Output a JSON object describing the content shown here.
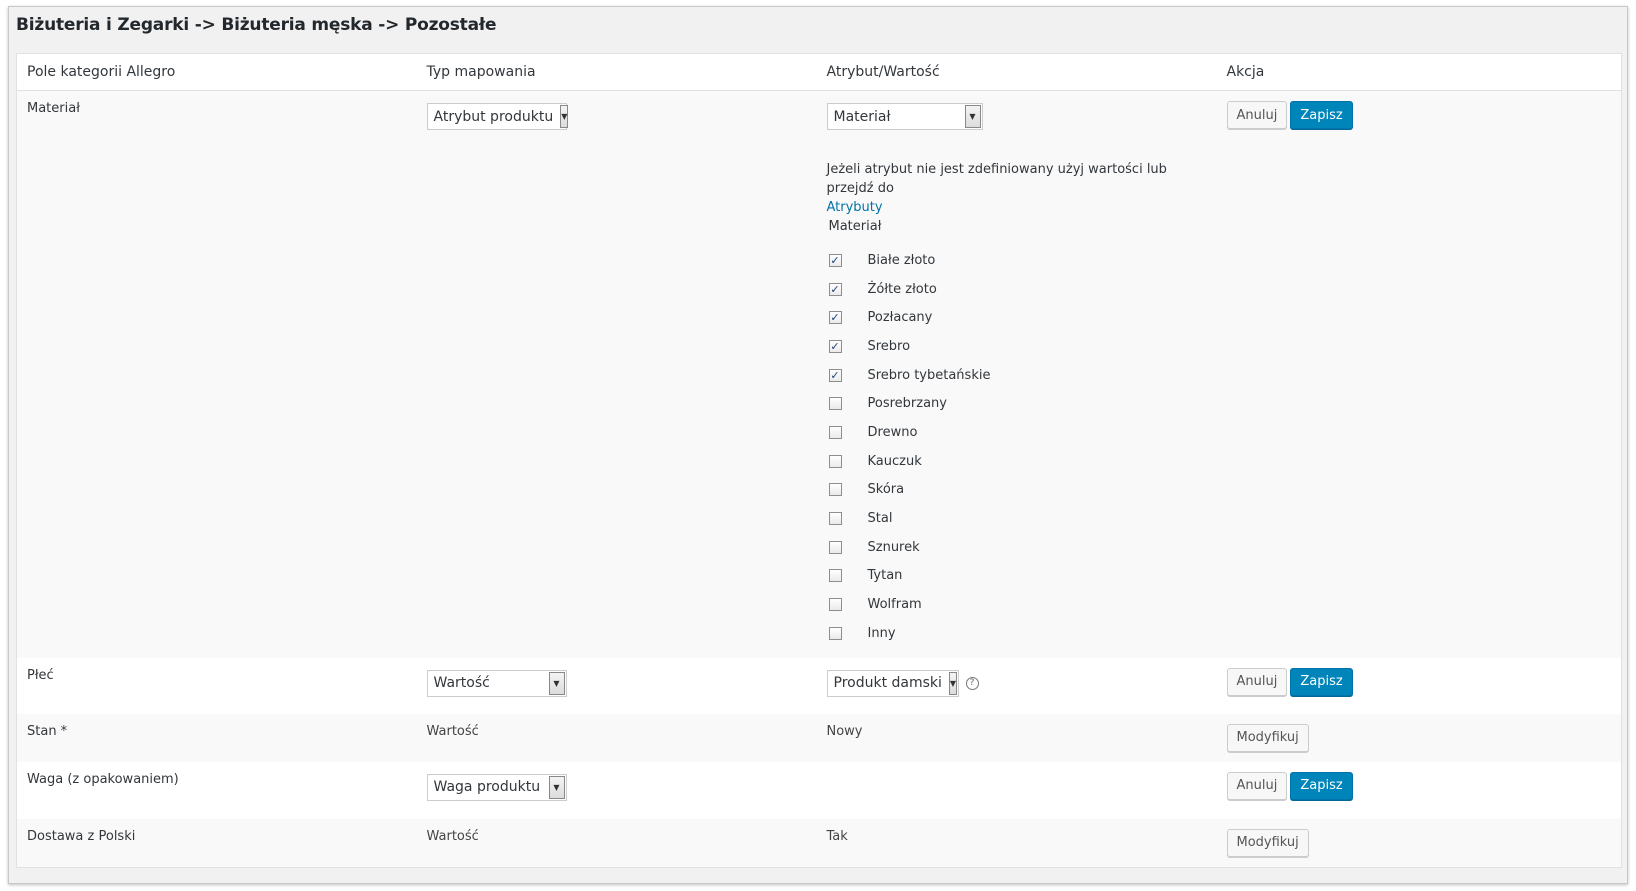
{
  "breadcrumb": "Biżuteria i Zegarki -> Biżuteria męska -> Pozostałe",
  "columns": [
    "Pole kategorii Allegro",
    "Typ mapowania",
    "Atrybut/Wartość",
    "Akcja"
  ],
  "buttons": {
    "cancel": "Anuluj",
    "save": "Zapisz",
    "modify": "Modyfikuj"
  },
  "rows": {
    "material": {
      "field": "Materiał",
      "mapping_type": "Atrybut produktu",
      "attribute": "Materiał",
      "info_text": "Jeżeli atrybut nie jest zdefiniowany użyj wartości lub przejdź do",
      "info_link": "Atrybuty",
      "values_label": "Materiał",
      "options": [
        {
          "label": "Białe złoto",
          "checked": true
        },
        {
          "label": "Żółte złoto",
          "checked": true
        },
        {
          "label": "Pozłacany",
          "checked": true
        },
        {
          "label": "Srebro",
          "checked": true
        },
        {
          "label": "Srebro tybetańskie",
          "checked": true
        },
        {
          "label": "Posrebrzany",
          "checked": false
        },
        {
          "label": "Drewno",
          "checked": false
        },
        {
          "label": "Kauczuk",
          "checked": false
        },
        {
          "label": "Skóra",
          "checked": false
        },
        {
          "label": "Stal",
          "checked": false
        },
        {
          "label": "Sznurek",
          "checked": false
        },
        {
          "label": "Tytan",
          "checked": false
        },
        {
          "label": "Wolfram",
          "checked": false
        },
        {
          "label": "Inny",
          "checked": false
        }
      ]
    },
    "gender": {
      "field": "Płeć",
      "mapping_type": "Wartość",
      "value": "Produkt damski"
    },
    "condition": {
      "field": "Stan *",
      "mapping_type": "Wartość",
      "value": "Nowy"
    },
    "weight": {
      "field": "Waga (z opakowaniem)",
      "mapping_type": "Waga produktu"
    },
    "shipping": {
      "field": "Dostawa z Polski",
      "mapping_type": "Wartość",
      "value": "Tak"
    }
  },
  "colors": {
    "primary": "#0085ba",
    "link": "#0073aa",
    "check": "#1e3f7a"
  },
  "icons": {
    "dropdown": "chevron-down-icon",
    "help": "help-icon",
    "check": "checkmark-icon"
  }
}
